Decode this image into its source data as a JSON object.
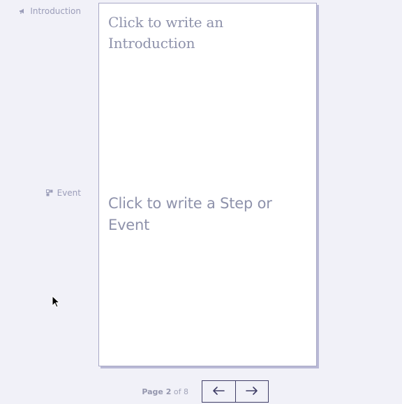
{
  "sidebar": {
    "intro_label": "Introduction",
    "intro_icon": "megaphone-icon",
    "event_label": "Event",
    "event_icon": "event-icon"
  },
  "page": {
    "intro_placeholder": "Click to write an Introduction",
    "event_placeholder": "Click to write a Step or Event"
  },
  "pager": {
    "page_word": "Page",
    "current_page": "2",
    "of_word": "of",
    "total_pages": "8",
    "prev_icon": "arrow-left-icon",
    "next_icon": "arrow-right-icon"
  },
  "colors": {
    "background": "#f1f1f8",
    "page": "#ffffff",
    "muted_text": "#9b9db9",
    "button_border": "#3f3d66"
  }
}
